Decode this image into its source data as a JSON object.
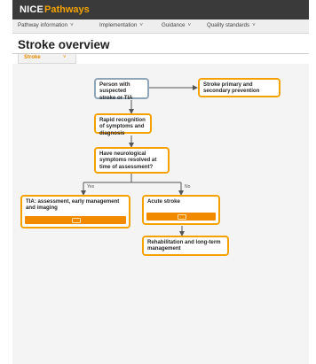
{
  "header": {
    "logo_nice": "NICE",
    "logo_pathways": "Pathways"
  },
  "nav": {
    "items": [
      {
        "label": "Pathway information"
      },
      {
        "label": "Implementation"
      },
      {
        "label": "Guidance"
      },
      {
        "label": "Quality standards"
      }
    ]
  },
  "page": {
    "title": "Stroke overview",
    "tab_label": "Stroke"
  },
  "flow": {
    "suspected": "Person with suspected stroke or TIA",
    "prevention": "Stroke primary and secondary prevention",
    "rapid": "Rapid recognition of symptoms and diagnosis",
    "question": "Have neurological symptoms resolved at time of assessment?",
    "yes": "Yes",
    "no": "No",
    "tia": "TIA: assessment, early management and imaging",
    "acute": "Acute stroke",
    "rehab": "Rehabilitation and long-term management"
  },
  "colors": {
    "accent": "#f5a200",
    "bar": "#f28a00",
    "start_node_border": "#8fa6b8",
    "header": "#3a3a3a"
  }
}
